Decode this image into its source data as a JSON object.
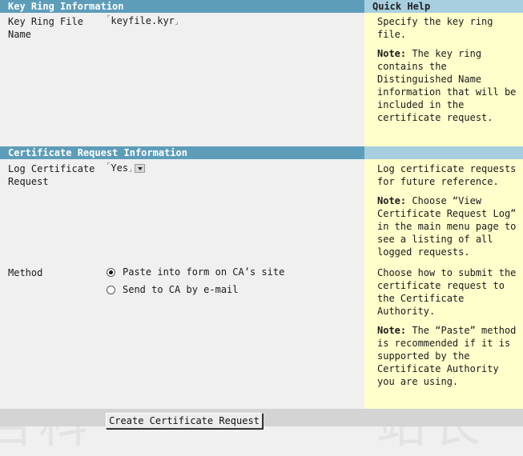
{
  "sections": {
    "keyring_header": "Key Ring Information",
    "quickhelp_header": "Quick Help",
    "cert_header": "Certificate Request Information"
  },
  "keyring": {
    "label": "Key Ring File Name",
    "value": "keyfile.kyr",
    "help_text": "Specify the key ring file.",
    "help_note_label": "Note:",
    "help_note": "The key ring contains the Distinguished Name information that will be included in the certificate request."
  },
  "log_request": {
    "label": "Log Certificate Request",
    "selected": "Yes",
    "help_text": "Log certificate requests for future reference.",
    "help_note_label": "Note:",
    "help_note": "Choose “View Certificate Request Log” in the main menu page to see a listing of all logged requests."
  },
  "method": {
    "label": "Method",
    "options": [
      {
        "label": "Paste into form on CA’s site",
        "checked": true
      },
      {
        "label": "Send to CA by e-mail",
        "checked": false
      }
    ],
    "help_text": "Choose how to submit the certificate request to the Certificate Authority.",
    "help_note_label": "Note:",
    "help_note": "The “Paste” method is recommended if it is supported by the Certificate Authority you are using."
  },
  "submit_button": "Create Certificate Request",
  "colors": {
    "header_bg": "#5d9db9",
    "help_bg": "#ffffcc",
    "page_bg": "#f0f0f0"
  }
}
